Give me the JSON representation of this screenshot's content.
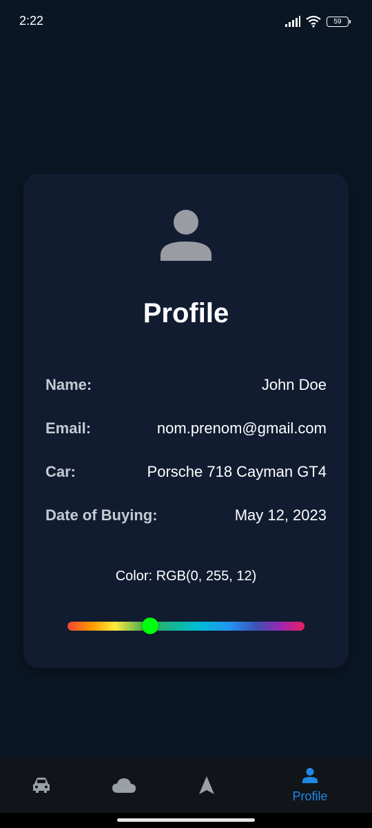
{
  "status_bar": {
    "time": "2:22",
    "battery": "59"
  },
  "profile": {
    "title": "Profile",
    "fields": [
      {
        "label": "Name:",
        "value": "John Doe"
      },
      {
        "label": "Email:",
        "value": "nom.prenom@gmail.com"
      },
      {
        "label": "Car:",
        "value": "Porsche 718 Cayman GT4"
      },
      {
        "label": "Date of Buying:",
        "value": "May 12, 2023"
      }
    ],
    "color_text": "Color: RGB(0, 255, 12)",
    "color_slider_value": 0.35,
    "selected_color": "#00ff0c"
  },
  "nav": {
    "items": [
      {
        "icon": "car-icon",
        "label": ""
      },
      {
        "icon": "cloud-icon",
        "label": ""
      },
      {
        "icon": "navigation-icon",
        "label": ""
      },
      {
        "icon": "person-icon",
        "label": "Profile",
        "active": true
      }
    ]
  },
  "colors": {
    "background": "#0b1624",
    "card": "#111c31",
    "accent": "#1e88e5",
    "inactive_icon": "#9aa0a6"
  }
}
